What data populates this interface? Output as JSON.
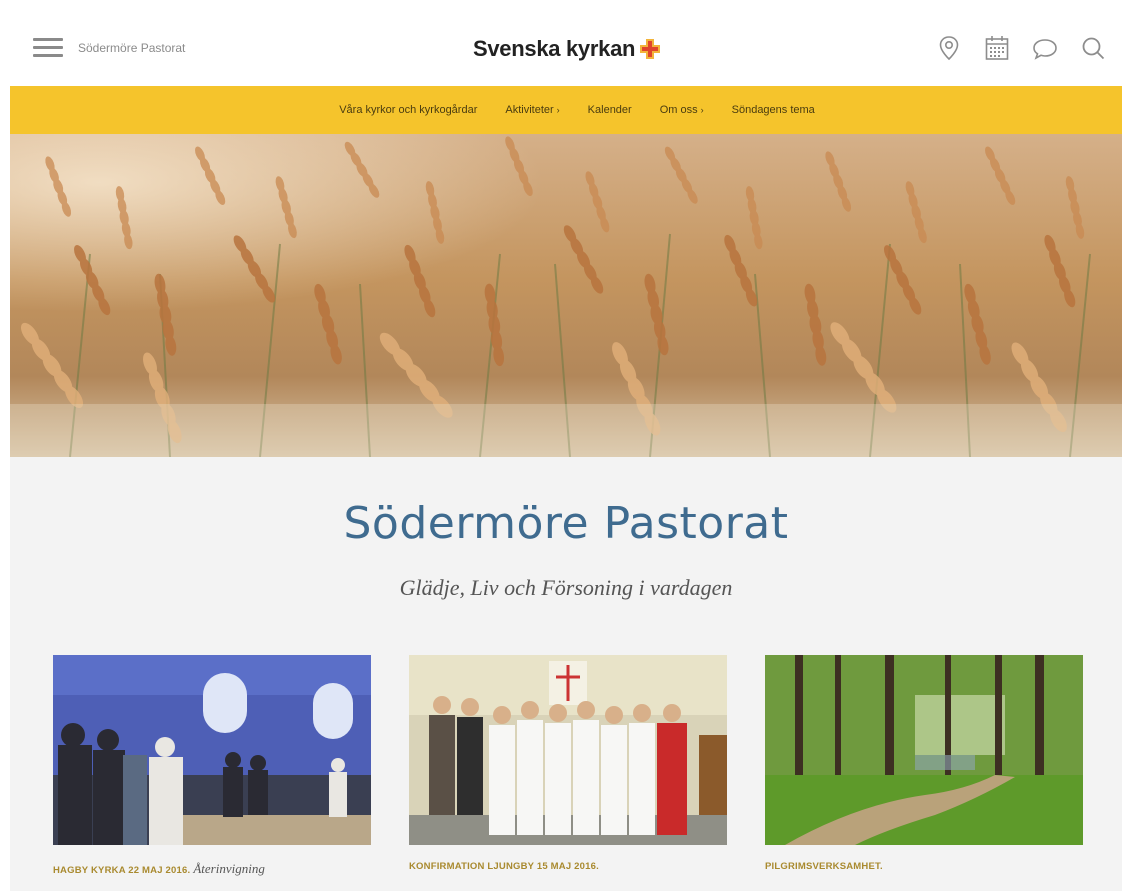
{
  "header": {
    "site_name": "Södermöre Pastorat",
    "logo_text": "Svenska kyrkan",
    "icons": [
      "location-pin-icon",
      "calendar-icon",
      "chat-bubble-icon",
      "search-icon"
    ]
  },
  "nav": {
    "items": [
      {
        "label": "Våra kyrkor och kyrkogårdar",
        "has_submenu": false
      },
      {
        "label": "Aktiviteter",
        "has_submenu": true
      },
      {
        "label": "Kalender",
        "has_submenu": false
      },
      {
        "label": "Om oss",
        "has_submenu": true
      },
      {
        "label": "Söndagens tema",
        "has_submenu": false
      }
    ],
    "chevron": "›"
  },
  "main": {
    "title": "Södermöre Pastorat",
    "subtitle": "Glädje, Liv och Försoning i vardagen"
  },
  "cards": [
    {
      "caption": "HAGBY KYRKA 22 MAJ 2016.",
      "caption_italic": "Återinvigning"
    },
    {
      "caption": "KONFIRMATION LJUNGBY 15 MAJ 2016.",
      "caption_italic": ""
    },
    {
      "caption": "PILGRIMSVERKSAMHET.",
      "caption_italic": ""
    }
  ],
  "colors": {
    "nav_bg": "#f5c42c",
    "title": "#3f6b8f",
    "caption": "#a98a2f",
    "logo_cross": "#e8782a"
  }
}
